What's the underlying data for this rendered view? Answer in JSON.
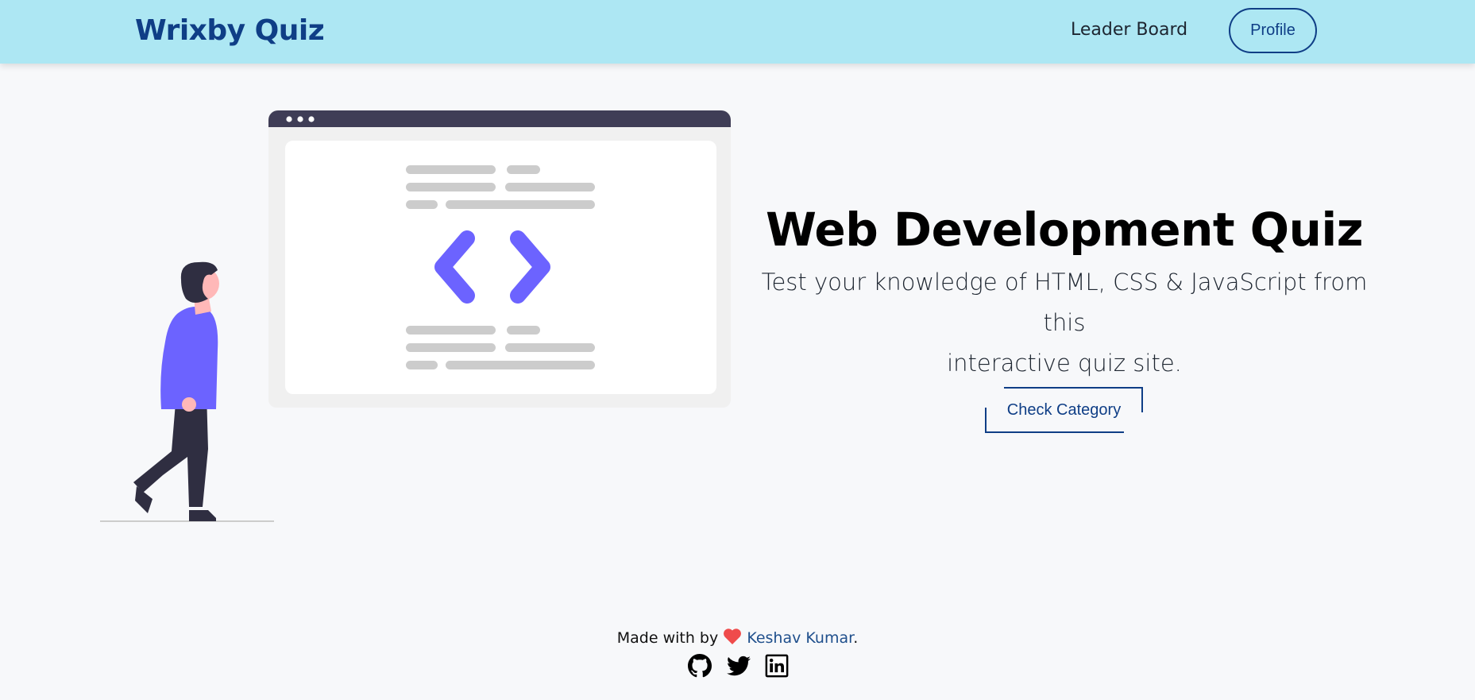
{
  "navbar": {
    "brand": "Wrixby Quiz",
    "links": [
      "Leader Board"
    ],
    "profile_label": "Profile"
  },
  "hero": {
    "title": "Web Development Quiz",
    "subtitle_line1": "Test your knowledge of HTML, CSS & JavaScript from this",
    "subtitle_line2": "interactive quiz site.",
    "cta_label": "Check Category"
  },
  "footer": {
    "made_with": "Made with by",
    "author": "Keshav Kumar",
    "period": ".",
    "socials": [
      "github-icon",
      "twitter-icon",
      "linkedin-icon"
    ]
  },
  "colors": {
    "navbar_bg": "#ade7f3",
    "brand": "#0f3e86",
    "accent_purple": "#6c63ff",
    "heart": "#ef4b4b",
    "page_bg": "#f7f8fa"
  }
}
